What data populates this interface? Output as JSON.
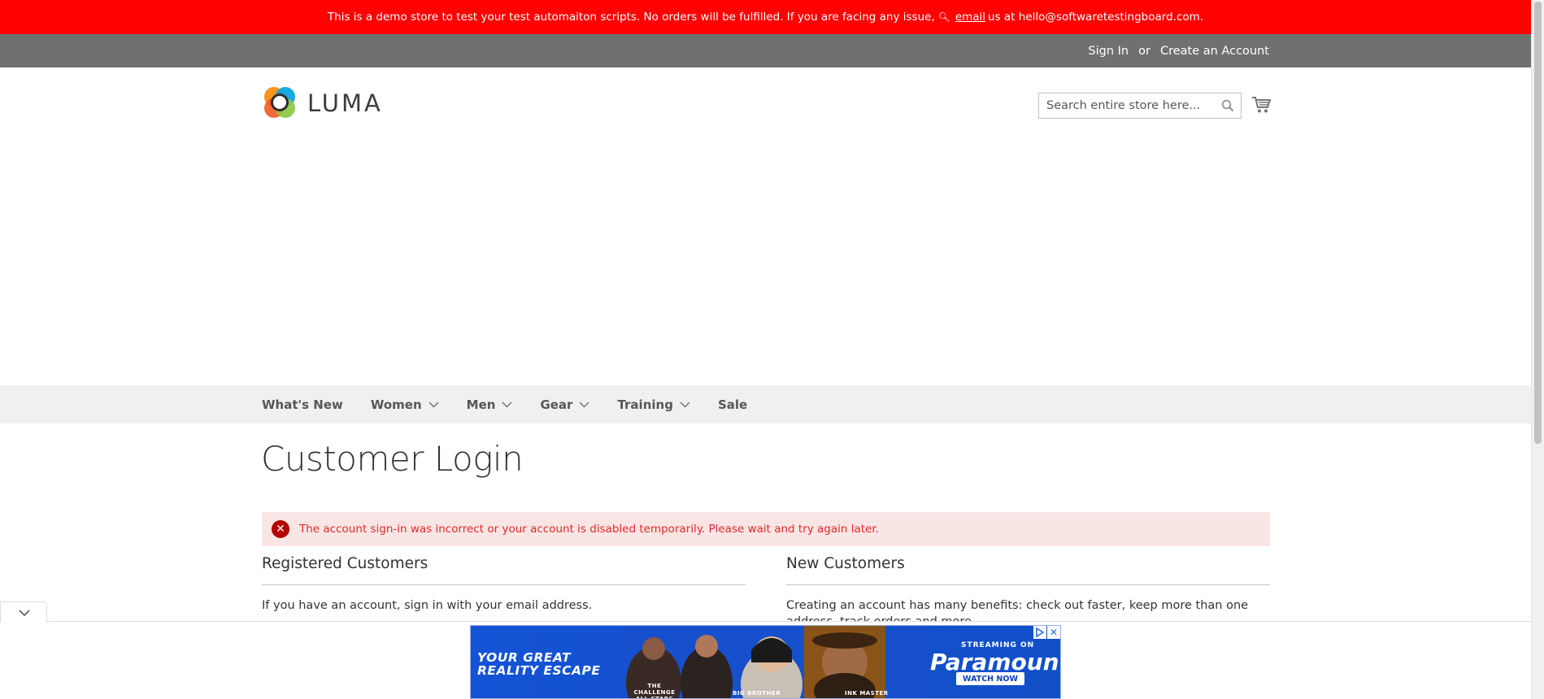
{
  "demo_notice": {
    "text_before": "This is a demo store to test your test automaiton scripts. No orders will be fulfilled. If you are facing any issue,",
    "link": "email",
    "text_after": "us at hello@softwaretestingboard.com."
  },
  "header": {
    "sign_in": "Sign In",
    "or": "or",
    "create_account": "Create an Account"
  },
  "logo": {
    "text": "LUMA"
  },
  "search": {
    "placeholder": "Search entire store here..."
  },
  "nav": [
    {
      "label": "What's New"
    },
    {
      "label": "Women"
    },
    {
      "label": "Men"
    },
    {
      "label": "Gear"
    },
    {
      "label": "Training"
    },
    {
      "label": "Sale"
    }
  ],
  "page": {
    "title": "Customer Login",
    "error": "The account sign-in was incorrect or your account is disabled temporarily. Please wait and try again later."
  },
  "registered": {
    "title": "Registered Customers",
    "text": "If you have an account, sign in with your email address."
  },
  "new_customers": {
    "title": "New Customers",
    "text": "Creating an account has many benefits: check out faster, keep more than one address, track orders and more."
  },
  "ad": {
    "headline_1": "YOUR GREAT",
    "headline_2": "REALITY ESCAPE",
    "streaming_on": "STREAMING ON",
    "brand": "Paramount+",
    "cta": "WATCH NOW",
    "caption_1": "THE CHALLENGE ALL STARS",
    "caption_2": "BIG BROTHER",
    "caption_3": "INK MASTER"
  },
  "colors": {
    "demo_bar": "#ff0101",
    "header_panel": "#6e716e",
    "nav_bg": "#f0f0f0",
    "error_bg": "#fae5e5",
    "error_text": "#e02b27"
  }
}
